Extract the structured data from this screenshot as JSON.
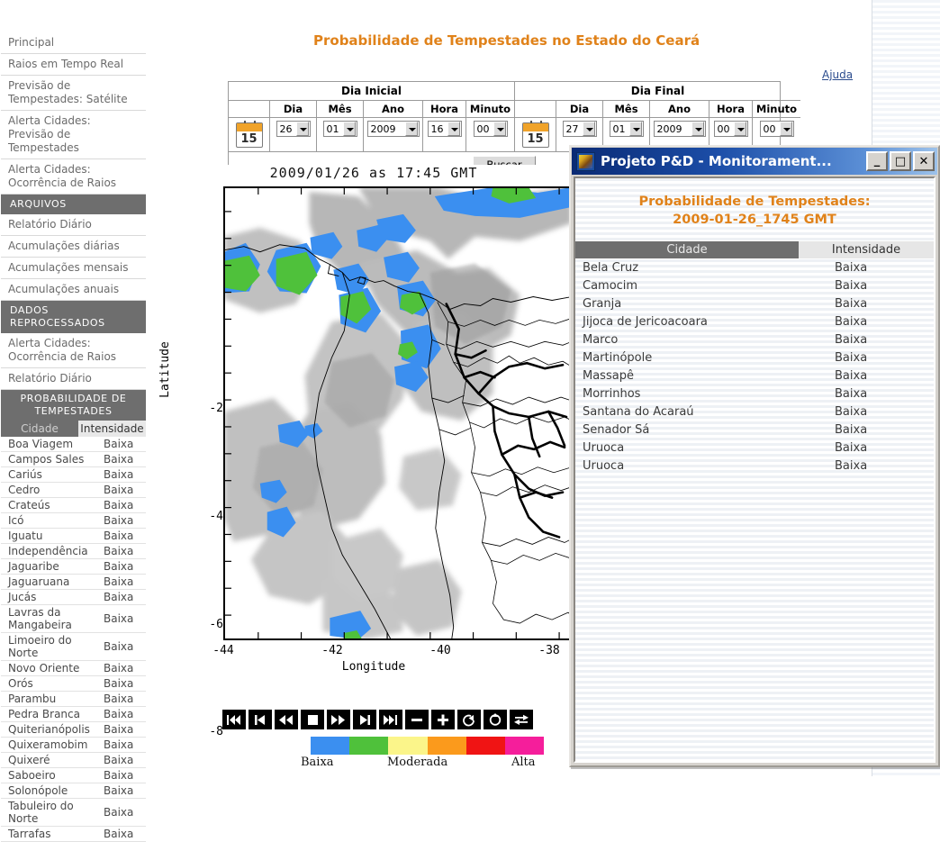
{
  "page": {
    "title": "Probabilidade de Tempestades no Estado do Ceará",
    "help_link": "Ajuda",
    "accent_color": "#e0821a"
  },
  "sidebar": {
    "links_top": [
      {
        "label": "Principal"
      },
      {
        "label": "Raios em Tempo Real"
      },
      {
        "label": "Previsão de Tempestades: Satélite"
      },
      {
        "label": "Alerta Cidades: Previsão de Tempestades"
      },
      {
        "label": "Alerta Cidades: Ocorrência de Raios"
      }
    ],
    "section_arquivos": "ARQUIVOS",
    "links_arquivos": [
      {
        "label": "Relatório Diário"
      },
      {
        "label": "Acumulações diárias"
      },
      {
        "label": "Acumulações mensais"
      },
      {
        "label": "Acumulações anuais"
      }
    ],
    "section_reprocessados": "DADOS REPROCESSADOS",
    "links_reprocessados": [
      {
        "label": "Alerta Cidades: Ocorrência de Raios"
      },
      {
        "label": "Relatório Diário"
      }
    ],
    "section_probabilidade": "PROBABILIDADE DE TEMPESTADES",
    "table_headers": {
      "city": "Cidade",
      "intensity": "Intensidade"
    },
    "rows": [
      {
        "city": "Boa Viagem",
        "intensity": "Baixa"
      },
      {
        "city": "Campos Sales",
        "intensity": "Baixa"
      },
      {
        "city": "Cariús",
        "intensity": "Baixa"
      },
      {
        "city": "Cedro",
        "intensity": "Baixa"
      },
      {
        "city": "Crateús",
        "intensity": "Baixa"
      },
      {
        "city": "Icó",
        "intensity": "Baixa"
      },
      {
        "city": "Iguatu",
        "intensity": "Baixa"
      },
      {
        "city": "Independência",
        "intensity": "Baixa"
      },
      {
        "city": "Jaguaribe",
        "intensity": "Baixa"
      },
      {
        "city": "Jaguaruana",
        "intensity": "Baixa"
      },
      {
        "city": "Jucás",
        "intensity": "Baixa"
      },
      {
        "city": "Lavras da Mangabeira",
        "intensity": "Baixa"
      },
      {
        "city": "Limoeiro do Norte",
        "intensity": "Baixa"
      },
      {
        "city": "Novo Oriente",
        "intensity": "Baixa"
      },
      {
        "city": "Orós",
        "intensity": "Baixa"
      },
      {
        "city": "Parambu",
        "intensity": "Baixa"
      },
      {
        "city": "Pedra Branca",
        "intensity": "Baixa"
      },
      {
        "city": "Quiterianópolis",
        "intensity": "Baixa"
      },
      {
        "city": "Quixeramobim",
        "intensity": "Baixa"
      },
      {
        "city": "Quixeré",
        "intensity": "Baixa"
      },
      {
        "city": "Saboeiro",
        "intensity": "Baixa"
      },
      {
        "city": "Solonópole",
        "intensity": "Baixa"
      },
      {
        "city": "Tabuleiro do Norte",
        "intensity": "Baixa"
      },
      {
        "city": "Tarrafas",
        "intensity": "Baixa"
      }
    ]
  },
  "form": {
    "start": {
      "caption": "Dia Inicial",
      "labels": {
        "dia": "Dia",
        "mes": "Mês",
        "ano": "Ano",
        "hora": "Hora",
        "minuto": "Minuto"
      },
      "values": {
        "dia": "26",
        "mes": "01",
        "ano": "2009",
        "hora": "16",
        "minuto": "00"
      }
    },
    "end": {
      "caption": "Dia Final",
      "labels": {
        "dia": "Dia",
        "mes": "Mês",
        "ano": "Ano",
        "hora": "Hora",
        "minuto": "Minuto"
      },
      "values": {
        "dia": "27",
        "mes": "01",
        "ano": "2009",
        "hora": "00",
        "minuto": "00"
      }
    },
    "calendar_icon_day": "15",
    "search_button": "Buscar"
  },
  "chart_data": {
    "type": "heatmap",
    "title": "2009/01/26 as 17:45 GMT",
    "xlabel": "Longitude",
    "ylabel": "Latitude",
    "xlim": [
      -45.2,
      -37.2
    ],
    "ylim": [
      -9.1,
      -1.0
    ],
    "xticks": [
      "-44",
      "-42",
      "-40",
      "-38"
    ],
    "yticks": [
      "-2",
      "-4",
      "-6",
      "-8"
    ],
    "grid": false,
    "colorbar": {
      "labels": [
        "Baixa",
        "Moderada",
        "Alta"
      ],
      "colors": [
        "#3b8ff0",
        "#4fc13b",
        "#fbf58a",
        "#fb9a1c",
        "#f01414",
        "#f51e9b"
      ]
    }
  },
  "player": {
    "buttons": [
      {
        "name": "skip-to-start",
        "glyph": "first"
      },
      {
        "name": "step-back-to-start",
        "glyph": "prev-bar"
      },
      {
        "name": "rewind",
        "glyph": "rewind"
      },
      {
        "name": "stop",
        "glyph": "stop"
      },
      {
        "name": "forward",
        "glyph": "forward"
      },
      {
        "name": "next-bar",
        "glyph": "next-bar"
      },
      {
        "name": "skip-to-end",
        "glyph": "last"
      },
      {
        "name": "slower",
        "glyph": "minus"
      },
      {
        "name": "faster",
        "glyph": "plus"
      },
      {
        "name": "loop-once",
        "glyph": "loop-once"
      },
      {
        "name": "loop",
        "glyph": "loop"
      },
      {
        "name": "swap",
        "glyph": "swap"
      }
    ]
  },
  "popup": {
    "window_title": "Projeto P&D - Monitorament...",
    "controls": {
      "minimize": "_",
      "maximize": "□",
      "close": "✕"
    },
    "heading_line1": "Probabilidade de Tempestades:",
    "heading_line2": "2009-01-26_1745 GMT",
    "table_headers": {
      "city": "Cidade",
      "intensity": "Intensidade"
    },
    "rows": [
      {
        "city": "Bela Cruz",
        "intensity": "Baixa"
      },
      {
        "city": "Camocim",
        "intensity": "Baixa"
      },
      {
        "city": "Granja",
        "intensity": "Baixa"
      },
      {
        "city": "Jijoca de Jericoacoara",
        "intensity": "Baixa"
      },
      {
        "city": "Marco",
        "intensity": "Baixa"
      },
      {
        "city": "Martinópole",
        "intensity": "Baixa"
      },
      {
        "city": "Massapê",
        "intensity": "Baixa"
      },
      {
        "city": "Morrinhos",
        "intensity": "Baixa"
      },
      {
        "city": "Santana do Acaraú",
        "intensity": "Baixa"
      },
      {
        "city": "Senador Sá",
        "intensity": "Baixa"
      },
      {
        "city": "Uruoca",
        "intensity": "Baixa"
      },
      {
        "city": "Uruoca",
        "intensity": "Baixa"
      }
    ]
  }
}
